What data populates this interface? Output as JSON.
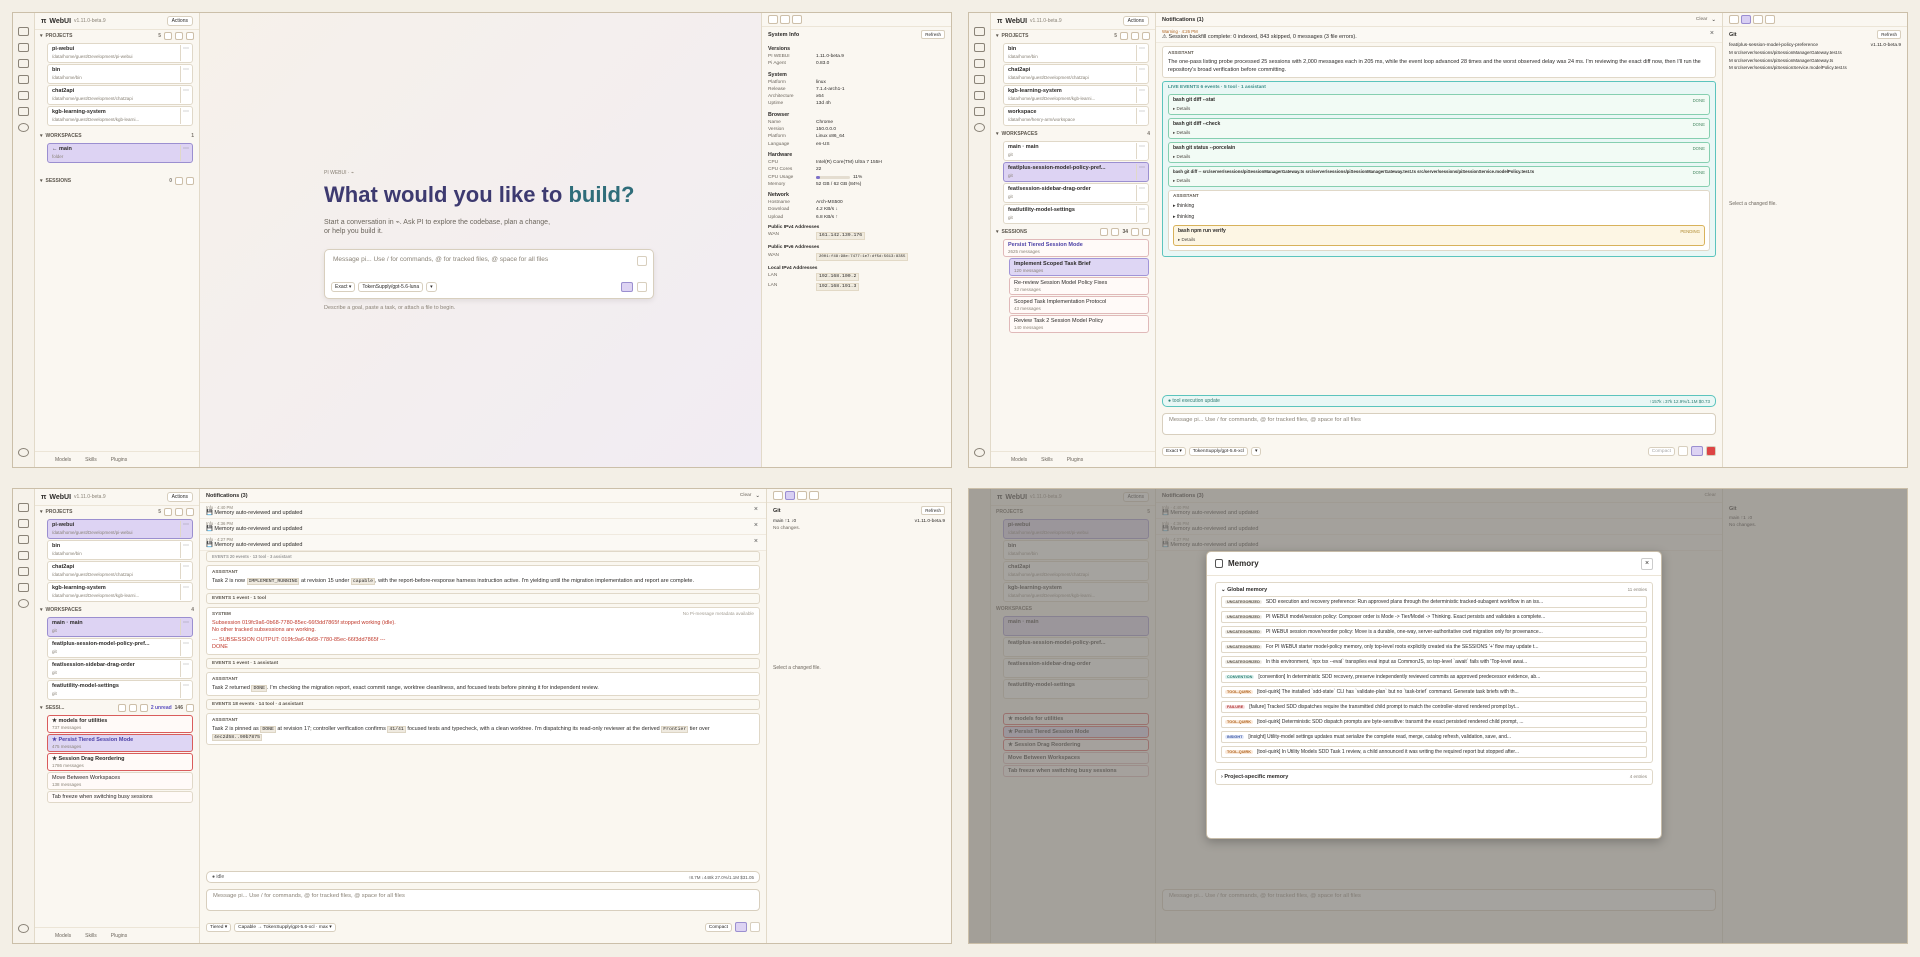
{
  "app": {
    "name": "WebUI",
    "version": "v1.11.0-beta.9",
    "actions": "Actions"
  },
  "common": {
    "projects": "PROJECTS",
    "projects_count": "5",
    "workspaces": "WORKSPACES",
    "workspaces_count_1": "1",
    "workspaces_count_4": "4",
    "sessions": "SESSIONS",
    "footer": {
      "models": "Models",
      "skills": "Skills",
      "plugins": "Plugins"
    },
    "more": "⋯",
    "refresh": "Refresh",
    "clear": "Clear"
  },
  "projects": [
    {
      "name": "pi-webui",
      "path": "/data/home/guest/Development/pi-webui"
    },
    {
      "name": "bin",
      "path": "/data/home/bin"
    },
    {
      "name": "chat2api",
      "path": "/data/home/guest/Development/chat2api"
    },
    {
      "name": "kgb-learning-system",
      "path": "/data/home/guest/Development/kgb-learni..."
    },
    {
      "name": "workspace",
      "path": "/data/home/henry-arm/workspace"
    }
  ],
  "p1": {
    "workspace_main": {
      "name": "← main",
      "sub": "folder"
    },
    "sessions_count": "0",
    "hero": {
      "kicker": "PI WEBUI · ⌁",
      "title_a": "What would you like to",
      "title_b": "build?",
      "sub1": "Start a conversation in ⌁. Ask PI to explore the codebase, plan a change,",
      "sub2": "or help you build it.",
      "placeholder": "Message pi... Use / for commands, @ for tracked files, @ space for all files",
      "mode": "Exact ▾",
      "model": "TokenSupply/gpt-5.6-luna",
      "level": "▾",
      "hint": "Describe a goal, paste a task, or attach a file to begin."
    },
    "sysinfo": {
      "title": "System Info",
      "versions": "Versions",
      "pi_webui_k": "PI WEBUI",
      "pi_webui_v": "1.11.0-beta.9",
      "pi_agent_k": "Pi Agent",
      "pi_agent_v": "0.83.0",
      "system": "System",
      "platform_k": "Platform",
      "platform_v": "linux",
      "release_k": "Release",
      "release_v": "7.1.4-arch1-1",
      "arch_k": "Architecture",
      "arch_v": "x64",
      "uptime_k": "Uptime",
      "uptime_v": "13d 4h",
      "browser": "Browser",
      "name_k": "Name",
      "name_v": "Chrome",
      "version_k": "Version",
      "version_v": "150.0.0.0",
      "bplatform_k": "Platform",
      "bplatform_v": "Linux x86_64",
      "lang_k": "Language",
      "lang_v": "en-US",
      "hardware": "Hardware",
      "cpu_k": "CPU",
      "cpu_v": "Intel(R) Core(TM) Ultra 7 155H",
      "cores_k": "CPU Cores",
      "cores_v": "22",
      "usage_k": "CPU Usage",
      "usage_v": "11%",
      "usage_frac": 0.11,
      "mem_k": "Memory",
      "mem_v": "52 GB / 62 GB (84%)",
      "network": "Network",
      "host_k": "Hostname",
      "host_v": "Arch-MS500",
      "dl_k": "Download",
      "dl_v": "4.2 KB/s ↓",
      "ul_k": "Upload",
      "ul_v": "6.8 KB/s ↑",
      "pub4": "Public IPv4 Addresses",
      "wan_k": "WAN",
      "wan4_v": "161.142.139.176",
      "pub6": "Public IPv6 Addresses",
      "wan6_v": "2001:f48:98e:7477:1e7:df5d:5613:8355",
      "loc4": "Local IPv4 Addresses",
      "lan_k": "LAN",
      "lan1_v": "192.168.100.2",
      "lan2_v": "192.168.191.3"
    }
  },
  "p2": {
    "workspaces": [
      {
        "name": "main · main",
        "sub": "git"
      },
      {
        "name": "feat/plus-session-model-policy-pref...",
        "sub": "git"
      },
      {
        "name": "feat/session-sidebar-drag-order",
        "sub": "git"
      },
      {
        "name": "feat/utility-model-settings",
        "sub": "git"
      }
    ],
    "sessions_count": "34",
    "sessions": [
      {
        "name": "Persist Tiered Session Mode",
        "meta": "2625 messages"
      },
      {
        "name": "Implement Scoped Task Brief",
        "meta": "120 messages"
      },
      {
        "name": "Re-review Session Model Policy Fixes",
        "meta": "32 messages"
      },
      {
        "name": "Scoped Task Implementation Protocol",
        "meta": "43 messages"
      },
      {
        "name": "Review Task 2 Session Model Policy",
        "meta": "140 messages"
      }
    ],
    "notif_title": "Notifications (1)",
    "notif": {
      "level": "Warning · 4:26 PM",
      "text": "⚠ Session backfill complete: 0 indexed, 843 skipped, 0 messages (3 file errors)."
    },
    "assistant1": "The one-pass listing probe processed 25 sessions with 2,000 messages each in 205 ms, while the event loop advanced 28 times and the worst observed delay was 24 ms. I'm reviewing the exact diff now, then I'll run the repository's broad verification before committing.",
    "live_events": "LIVE EVENTS  6 events · 5 tool · 1 assistant",
    "tools": [
      {
        "cmd": "bash  git diff --stat",
        "status": "DONE"
      },
      {
        "cmd": "bash  git diff --check",
        "status": "DONE"
      },
      {
        "cmd": "bash  git status --porcelain",
        "status": "DONE"
      },
      {
        "cmd": "bash  git diff -- src/server/sessions/piSessionManagerGateway.ts src/server/sessions/piSessionManagerGateway.test.ts src/server/sessions/piSessionService.modelPolicy.test.ts",
        "status": "DONE"
      }
    ],
    "details": "▸ Details",
    "assistant": "ASSISTANT",
    "thinking": "▸ thinking",
    "pending_tool": {
      "cmd": "bash  npm run verify",
      "status": "PENDING"
    },
    "tool_update": "● tool execution update",
    "usage": "↑157k  ↓37k  12.9%/1.1M  $0.73",
    "placeholder": "Message pi... Use / for commands, @ for tracked files, @ space for all files",
    "mode": "Exact ▾",
    "model": "TokenSupply/gpt-5.6-xcl",
    "compact": "Compact",
    "git": {
      "title": "Git",
      "branch": "feat/plus-session-model-policy-preference",
      "ver": "v1.11.0-beta.9",
      "files": [
        "M  src/server/sessions/piSessionManagerGateway.test.ts",
        "M  src/server/sessions/piSessionManagerGateway.ts",
        "M  src/server/sessions/piSessionService.modelPolicy.test.ts"
      ],
      "empty": "Select a changed file."
    }
  },
  "p3": {
    "notif_title": "Notifications (3)",
    "notifs": [
      {
        "level": "Info · 4:40 PM",
        "text": "💾 Memory auto-reviewed and updated"
      },
      {
        "level": "Info · 4:36 PM",
        "text": "💾 Memory auto-reviewed and updated"
      },
      {
        "level": "Info · 4:27 PM",
        "text": "💾 Memory auto-reviewed and updated"
      }
    ],
    "ev0": "EVENTS  20 events · 13 tool · 3 assistant",
    "a1_pre": "Task 2 is now",
    "a1_code": "IMPLEMENT_RUNNING",
    "a1_mid": "at revision 15 under",
    "a1_code2": "capable",
    "a1_post": ", with the report-before-response harness instruction active. I'm yielding until the migration implementation and report are complete.",
    "ev1": "EVENTS  1 event · 1 tool",
    "system": "SYSTEM",
    "system_meta": "No Pi-message metadata available",
    "sys1": "Subsession 019fc9a6-0b68-7780-85ec-66f3dd7865f stopped working (idle).",
    "sys2": "No other tracked subsessions are working.",
    "sys3": "--- SUBSESSION OUTPUT: 019fc9a6-0b68-7780-85ec-66f3dd7865f ---",
    "sys4": "DONE",
    "ev2": "EVENTS  1 event · 1 assistant",
    "a2_pre": "Task 2 returned",
    "a2_code": "DONE",
    "a2_post": ". I'm checking the migration report, exact commit range, worktree cleanliness, and focused tests before pinning it for independent review.",
    "ev3": "EVENTS  18 events · 14 tool · 4 assistant",
    "a3_pre": "Task 2 is pinned as",
    "a3_code": "DONE",
    "a3_mid": "at revision 17; controller verification confirms",
    "a3_code2": "41/41",
    "a3_post": "focused tests and typecheck, with a clean worktree. I'm dispatching its read-only reviewer at the derived",
    "a3_code3": "Frontier",
    "a3_tail": "tier over",
    "a3_code4": "4ec2d58..90b7875",
    "idle": "● idle",
    "usage": "↑8.7M  ↓448k  27.0%/1.1M  $31.05",
    "placeholder": "Message pi... Use / for commands, @ for tracked files, @ space for all files",
    "mode": "Tiered ▾",
    "model": "Capable → TokenSupply/gpt-5.6-xcl · max ▾",
    "compact": "Compact",
    "sessions_label": "SESSI...",
    "unread": "2 unread",
    "sess_count": "146",
    "sessions": [
      {
        "name": "★ models for utilities",
        "meta": "737 messages"
      },
      {
        "name": "★ Persist Tiered Session Mode",
        "meta": "475 messages"
      },
      {
        "name": "★ Session Drag Reordering",
        "meta": "1786 messages"
      },
      {
        "name": "Move Between Workspaces",
        "meta": "138 messages"
      },
      {
        "name": "Tab freeze when switching busy sessions",
        "meta": ""
      }
    ],
    "git": {
      "title": "Git",
      "branch": "main ↑1 ↓0",
      "ver": "v1.11.0-beta.9",
      "nochanges": "No changes.",
      "empty": "Select a changed file."
    }
  },
  "p4": {
    "memory_title": "Memory",
    "global": "Global memory",
    "global_count": "11 entries",
    "entries": [
      {
        "tag": "UNCATEGORIZED",
        "kind": "u",
        "text": "SDD execution and recovery preference: Run approved plans through the deterministic tracked-subagent workflow in an iss..."
      },
      {
        "tag": "UNCATEGORIZED",
        "kind": "u",
        "text": "PI WEBUI model/session policy: Composer order is Mode -> Tier/Model -> Thinking. Exact persists and validates a complete..."
      },
      {
        "tag": "UNCATEGORIZED",
        "kind": "u",
        "text": "PI WEBUI session move/reorder policy: Move is a durable, one-way, server-authoritative cwd migration only for provenance..."
      },
      {
        "tag": "UNCATEGORIZED",
        "kind": "u",
        "text": "For PI WEBUI starter model-policy memory, only top-level roots explicitly created via the SESSIONS '+' flow may update t..."
      },
      {
        "tag": "UNCATEGORIZED",
        "kind": "u",
        "text": "In this environment, `npx tsx --eval` transpiles eval input as CommonJS, so top-level `await` fails with 'Top-level awai..."
      },
      {
        "tag": "CONVENTION",
        "kind": "c",
        "text": "[convention] In deterministic SDD recovery, preserve independently reviewed commits as approved predecessor evidence, ab..."
      },
      {
        "tag": "TOOL-QUIRK",
        "kind": "q",
        "text": "[tool-quirk] The installed `sdd-state` CLI has `validate-plan` but no `task-brief` command. Generate task briefs with th..."
      },
      {
        "tag": "FAILURE",
        "kind": "f",
        "text": "[failure] Tracked SDD dispatches require the transmitted child prompt to match the controller-stored rendered prompt byt..."
      },
      {
        "tag": "TOOL-QUIRK",
        "kind": "q",
        "text": "[tool-quirk] Deterministic SDD dispatch prompts are byte-sensitive: transmit the exact persisted rendered child prompt, ..."
      },
      {
        "tag": "INSIGHT",
        "kind": "i",
        "text": "[insight] Utility-model settings updates must serialize the complete read, merge, catalog refresh, validation, save, and..."
      },
      {
        "tag": "TOOL-QUIRK",
        "kind": "q",
        "text": "[tool-quirk] In Utility Models SDD Task 1 review, a child announced it was writing the required report but stopped after..."
      }
    ],
    "project": "Project-specific memory",
    "project_count": "4 entries"
  }
}
